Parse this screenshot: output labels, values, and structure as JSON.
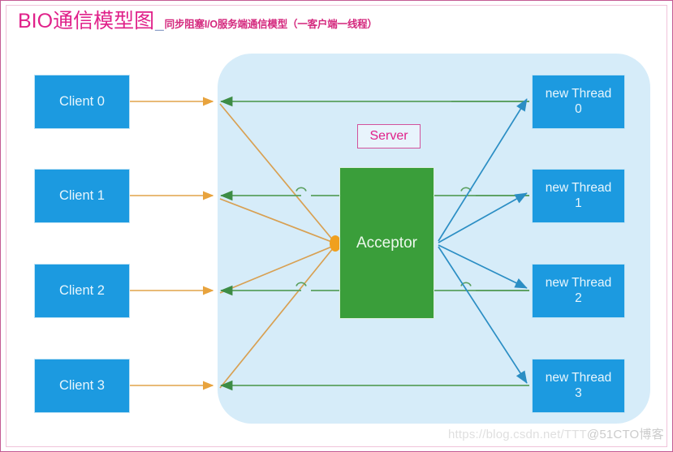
{
  "title": {
    "main": "BIO通信模型图",
    "separator": "_",
    "subtitle": "同步阻塞I/O服务端通信模型（一客户端一线程）"
  },
  "server": {
    "label": "Server",
    "acceptor_label": "Acceptor"
  },
  "clients": [
    {
      "label": "Client 0"
    },
    {
      "label": "Client 1"
    },
    {
      "label": "Client 2"
    },
    {
      "label": "Client 3"
    }
  ],
  "threads": [
    {
      "line1": "new Thread",
      "line2": "0"
    },
    {
      "line1": "new Thread",
      "line2": "1"
    },
    {
      "line1": "new Thread",
      "line2": "2"
    },
    {
      "line1": "new Thread",
      "line2": "3"
    }
  ],
  "watermark": {
    "site": "https://blog.csdn.net/TTT",
    "tag": "@51CTO博客"
  },
  "colors": {
    "node_blue": "#1c9ae0",
    "acceptor_green": "#3a9e3a",
    "panel_blue": "#d6ecf9",
    "title_pink": "#e0218a",
    "frame_pink": "#c35b94",
    "request_orange": "#e8a33d",
    "response_green": "#4f9e55",
    "dispatch_blue": "#2b8ec4"
  }
}
